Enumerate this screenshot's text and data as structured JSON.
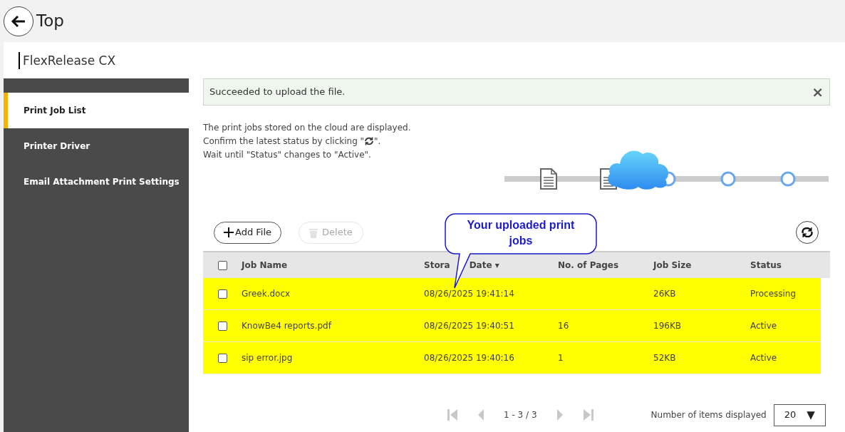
{
  "header": {
    "back_label": "Top"
  },
  "app_title": "FlexRelease CX",
  "sidebar": {
    "items": [
      {
        "label": "Print Job List",
        "selected": true
      },
      {
        "label": "Printer Driver",
        "selected": false
      },
      {
        "label": "Email Attachment Print Settings",
        "selected": false
      }
    ]
  },
  "alert": {
    "message": "Succeeded to upload the file.",
    "close": "×"
  },
  "instructions": {
    "line_1": "The print jobs stored on the cloud are displayed.",
    "line_2_before": "Confirm the latest status by clicking \"",
    "line_2_after": "\".",
    "line_3": "Wait until \"Status\" changes to \"Active\"."
  },
  "steps": [
    {
      "kind": "document"
    },
    {
      "kind": "document"
    },
    {
      "kind": "cloud"
    },
    {
      "kind": "circle"
    },
    {
      "kind": "circle"
    },
    {
      "kind": "circle"
    }
  ],
  "toolbar": {
    "add": "Add File",
    "delete": "Delete",
    "delete_disabled": true
  },
  "callout": "Your uploaded print jobs",
  "table": {
    "select_all_checked": false,
    "columns": [
      {
        "label": "Job Name"
      },
      {
        "label": "Stora",
        "label_tail": "Date ▾"
      },
      {
        "label": "No. of Pages"
      },
      {
        "label": "Job Size"
      },
      {
        "label": "Status"
      }
    ],
    "rows": [
      {
        "checked": false,
        "highlighted": true,
        "name": "Greek.docx",
        "date": "08/26/2025 19:41:14",
        "size": "26KB",
        "status": "Processing"
      },
      {
        "checked": false,
        "highlighted": true,
        "name": "KnowBe4 reports.pdf",
        "date": "08/26/2025 19:40:51",
        "pages": "16",
        "size": "196KB",
        "status": "Active"
      },
      {
        "checked": false,
        "highlighted": true,
        "name": "sip error.jpg",
        "date": "08/26/2025 19:40:16",
        "pages": "1",
        "size": "52KB",
        "status": "Active"
      }
    ]
  },
  "pagination": {
    "range": "1 - 3 / 3",
    "items_label": "Number of items displayed",
    "per_page": "20",
    "caret": "▼"
  }
}
